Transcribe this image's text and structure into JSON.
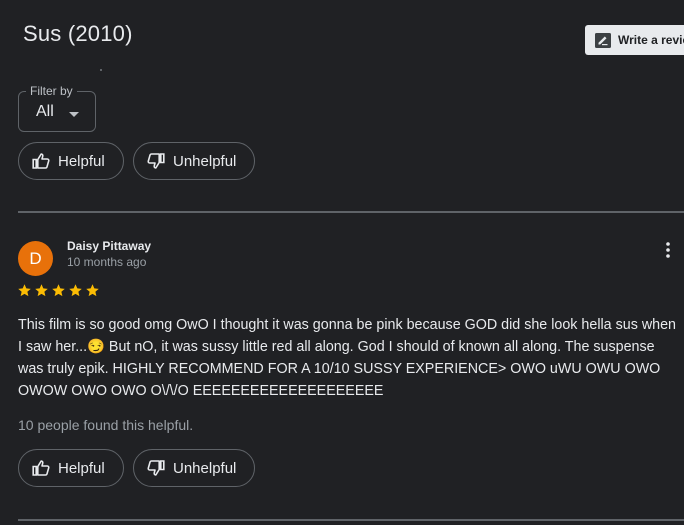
{
  "page": {
    "title": "Sus (2010)",
    "write_review_label": "Write a review"
  },
  "filter": {
    "legend": "Filter by",
    "selected": "All"
  },
  "votes": {
    "helpful_label": "Helpful",
    "unhelpful_label": "Unhelpful"
  },
  "review": {
    "avatar_letter": "D",
    "reviewer_name": "Daisy Pittaway",
    "date": "10 months ago",
    "rating": 5,
    "rating_max": 5,
    "text": "This film is so good omg OwO I thought it was gonna be pink because GOD did she look hella sus when I saw her...😏 But nO, it was sussy little red all along. God I should of known all along. The suspense was truly epik. HIGHLY RECOMMEND FOR A 10/10 SUSSY EXPERIENCE> OWO uWU OWU OWO OWOW OWO OWO O\\/\\/O EEEEEEEEEEEEEEEEEEEE",
    "found_helpful": "10 people found this helpful."
  },
  "colors": {
    "background": "#202124",
    "avatar": "#e8710a",
    "star": "#fbbc04",
    "outline": "#5f6368"
  },
  "icons": [
    "edit-review-icon",
    "thumb-up-icon",
    "thumb-down-icon",
    "dropdown-caret-icon",
    "more-vert-icon",
    "star-icon"
  ]
}
